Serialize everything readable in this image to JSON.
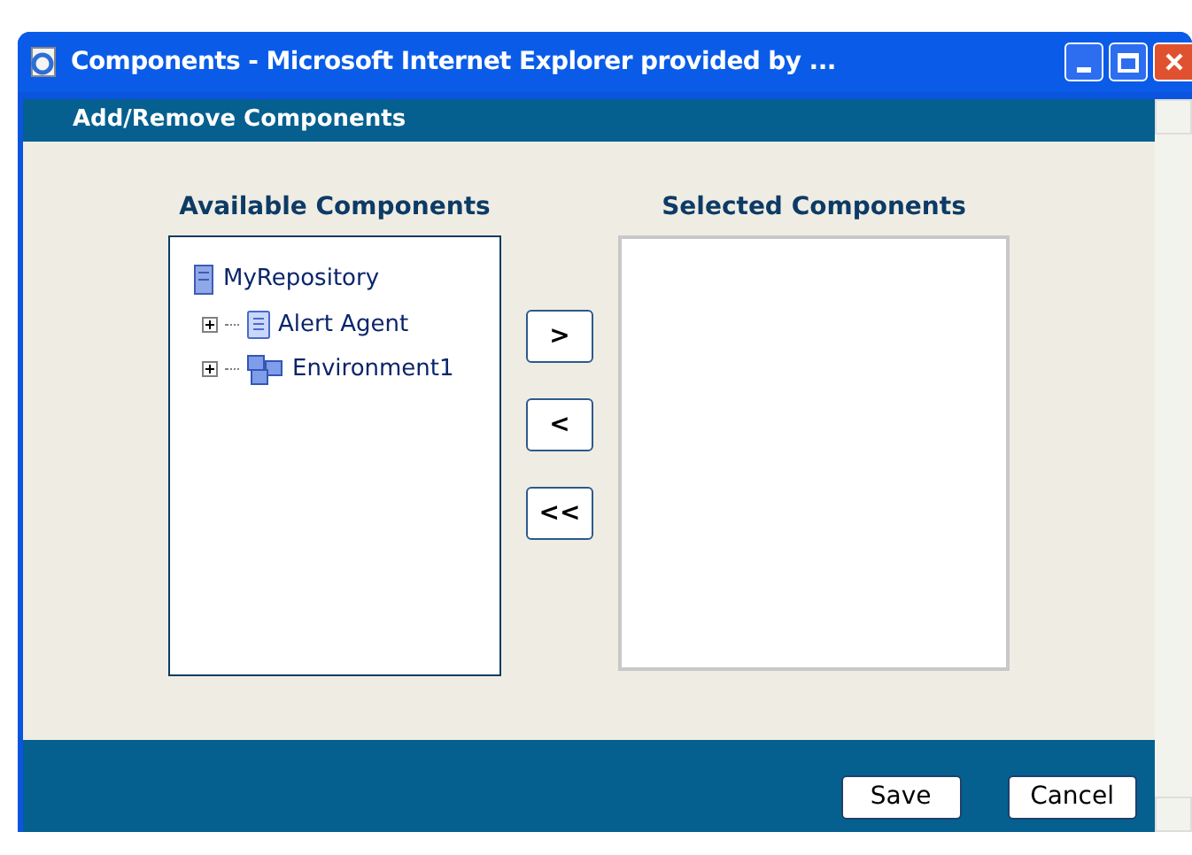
{
  "window": {
    "title": "Components - Microsoft Internet Explorer provided by ..."
  },
  "header": {
    "title": "Add/Remove Components"
  },
  "available": {
    "title": "Available Components",
    "tree": [
      {
        "label": "MyRepository",
        "kind": "repository",
        "children": [
          {
            "label": "Alert Agent",
            "kind": "agent",
            "expanded": false
          },
          {
            "label": "Environment1",
            "kind": "environment",
            "expanded": false
          }
        ]
      }
    ]
  },
  "move_buttons": [
    ">",
    "<",
    "<<"
  ],
  "selected": {
    "title": "Selected Components"
  },
  "buttons": [
    "Save",
    "Cancel"
  ]
}
